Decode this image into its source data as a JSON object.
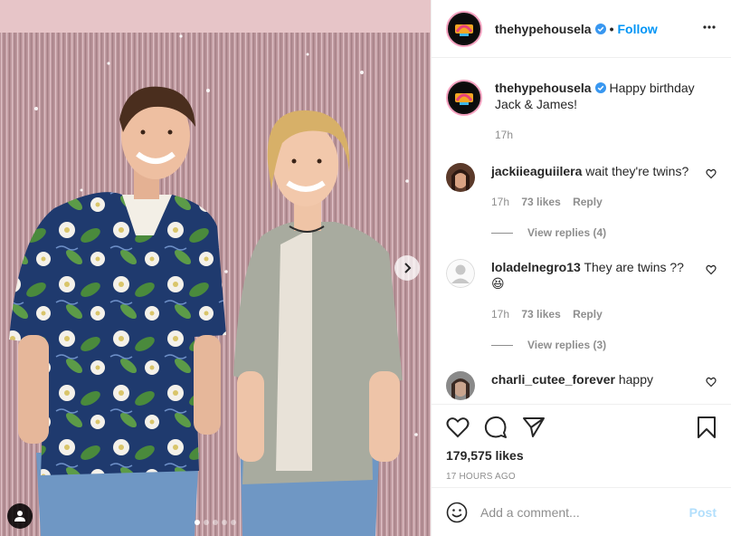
{
  "post": {
    "username": "thehypehousela",
    "follow_label": "Follow",
    "separator": "•",
    "caption_text": "Happy birthday Jack & James!",
    "caption_time": "17h",
    "likes": "179,575 likes",
    "posted_ago": "17 HOURS AGO",
    "carousel": {
      "slides": 5,
      "active_index": 0
    }
  },
  "comments": [
    {
      "username": "jackiieaguiilera",
      "text": "wait they're twins?",
      "time": "17h",
      "likes": "73 likes",
      "reply_label": "Reply",
      "view_replies": "View replies (4)"
    },
    {
      "username": "loladelnegro13",
      "text": "They are twins ??",
      "emoji": "😆",
      "time": "17h",
      "likes": "73 likes",
      "reply_label": "Reply",
      "view_replies": "View replies (3)"
    },
    {
      "username": "charli_cutee_forever",
      "text": "happy"
    }
  ],
  "add_comment": {
    "placeholder": "Add a comment...",
    "post_label": "Post"
  },
  "colors": {
    "link_blue": "#0095f6",
    "muted": "#8e8e8e",
    "post_disabled": "#b2dffc",
    "verified": "#3897f0"
  },
  "icons": [
    "user-tag-icon",
    "next-arrow-icon",
    "verified-icon",
    "more-options-icon",
    "heart-icon",
    "comment-icon",
    "share-icon",
    "bookmark-icon",
    "emoji-icon"
  ]
}
